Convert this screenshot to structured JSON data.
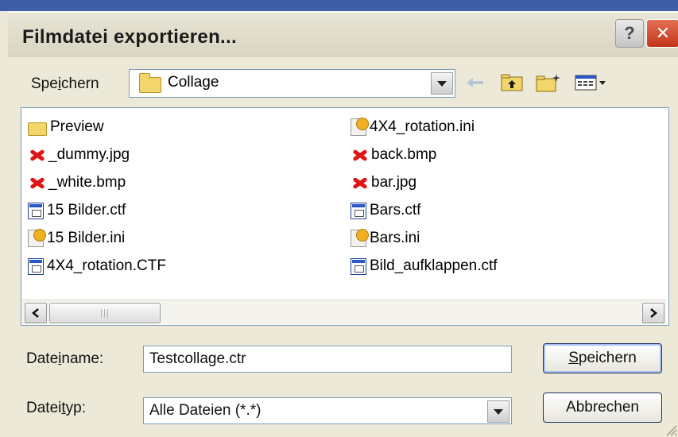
{
  "window": {
    "title": "Filmdatei exportieren...",
    "help_label": "?",
    "close_label": "✕"
  },
  "save_in": {
    "label_pre": "Spe",
    "label_underline": "i",
    "label_post": "chern",
    "folder_name": "Collage"
  },
  "toolbar": {
    "back_icon": "back-arrow-icon",
    "up_icon": "folder-up-icon",
    "new_folder_icon": "new-folder-icon",
    "view_icon": "view-menu-icon"
  },
  "files": {
    "col1": [
      {
        "name": "Preview",
        "type": "folder"
      },
      {
        "name": "_dummy.jpg",
        "type": "image"
      },
      {
        "name": "_white.bmp",
        "type": "image"
      },
      {
        "name": "15 Bilder.ctf",
        "type": "ctf"
      },
      {
        "name": "15 Bilder.ini",
        "type": "ini"
      },
      {
        "name": "4X4_rotation.CTF",
        "type": "ctf"
      }
    ],
    "col2": [
      {
        "name": "4X4_rotation.ini",
        "type": "ini"
      },
      {
        "name": "back.bmp",
        "type": "image"
      },
      {
        "name": "bar.jpg",
        "type": "image"
      },
      {
        "name": "Bars.ctf",
        "type": "ctf"
      },
      {
        "name": "Bars.ini",
        "type": "ini"
      },
      {
        "name": "Bild_aufklappen.ctf",
        "type": "ctf"
      }
    ]
  },
  "filename": {
    "label_pre": "Date",
    "label_underline": "i",
    "label_post": "name:",
    "value": "Testcollage.ctr"
  },
  "filetype": {
    "label_pre": "Datei",
    "label_underline": "t",
    "label_post": "yp:",
    "value": "Alle Dateien (*.*)"
  },
  "buttons": {
    "save_underline": "S",
    "save_rest": "peichern",
    "cancel": "Abbrechen"
  }
}
